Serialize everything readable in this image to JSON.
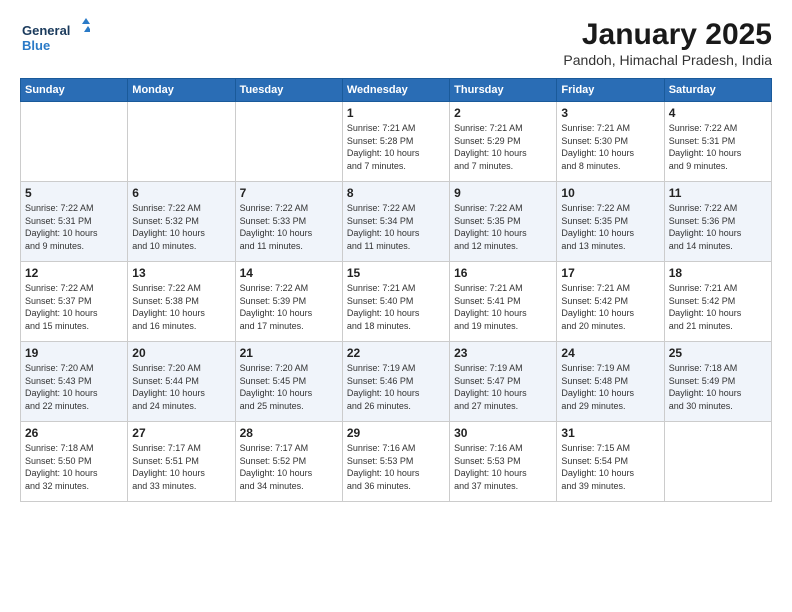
{
  "logo": {
    "line1": "General",
    "line2": "Blue"
  },
  "title": "January 2025",
  "subtitle": "Pandoh, Himachal Pradesh, India",
  "weekdays": [
    "Sunday",
    "Monday",
    "Tuesday",
    "Wednesday",
    "Thursday",
    "Friday",
    "Saturday"
  ],
  "weeks": [
    [
      {
        "day": "",
        "info": ""
      },
      {
        "day": "",
        "info": ""
      },
      {
        "day": "",
        "info": ""
      },
      {
        "day": "1",
        "info": "Sunrise: 7:21 AM\nSunset: 5:28 PM\nDaylight: 10 hours\nand 7 minutes."
      },
      {
        "day": "2",
        "info": "Sunrise: 7:21 AM\nSunset: 5:29 PM\nDaylight: 10 hours\nand 7 minutes."
      },
      {
        "day": "3",
        "info": "Sunrise: 7:21 AM\nSunset: 5:30 PM\nDaylight: 10 hours\nand 8 minutes."
      },
      {
        "day": "4",
        "info": "Sunrise: 7:22 AM\nSunset: 5:31 PM\nDaylight: 10 hours\nand 9 minutes."
      }
    ],
    [
      {
        "day": "5",
        "info": "Sunrise: 7:22 AM\nSunset: 5:31 PM\nDaylight: 10 hours\nand 9 minutes."
      },
      {
        "day": "6",
        "info": "Sunrise: 7:22 AM\nSunset: 5:32 PM\nDaylight: 10 hours\nand 10 minutes."
      },
      {
        "day": "7",
        "info": "Sunrise: 7:22 AM\nSunset: 5:33 PM\nDaylight: 10 hours\nand 11 minutes."
      },
      {
        "day": "8",
        "info": "Sunrise: 7:22 AM\nSunset: 5:34 PM\nDaylight: 10 hours\nand 11 minutes."
      },
      {
        "day": "9",
        "info": "Sunrise: 7:22 AM\nSunset: 5:35 PM\nDaylight: 10 hours\nand 12 minutes."
      },
      {
        "day": "10",
        "info": "Sunrise: 7:22 AM\nSunset: 5:35 PM\nDaylight: 10 hours\nand 13 minutes."
      },
      {
        "day": "11",
        "info": "Sunrise: 7:22 AM\nSunset: 5:36 PM\nDaylight: 10 hours\nand 14 minutes."
      }
    ],
    [
      {
        "day": "12",
        "info": "Sunrise: 7:22 AM\nSunset: 5:37 PM\nDaylight: 10 hours\nand 15 minutes."
      },
      {
        "day": "13",
        "info": "Sunrise: 7:22 AM\nSunset: 5:38 PM\nDaylight: 10 hours\nand 16 minutes."
      },
      {
        "day": "14",
        "info": "Sunrise: 7:22 AM\nSunset: 5:39 PM\nDaylight: 10 hours\nand 17 minutes."
      },
      {
        "day": "15",
        "info": "Sunrise: 7:21 AM\nSunset: 5:40 PM\nDaylight: 10 hours\nand 18 minutes."
      },
      {
        "day": "16",
        "info": "Sunrise: 7:21 AM\nSunset: 5:41 PM\nDaylight: 10 hours\nand 19 minutes."
      },
      {
        "day": "17",
        "info": "Sunrise: 7:21 AM\nSunset: 5:42 PM\nDaylight: 10 hours\nand 20 minutes."
      },
      {
        "day": "18",
        "info": "Sunrise: 7:21 AM\nSunset: 5:42 PM\nDaylight: 10 hours\nand 21 minutes."
      }
    ],
    [
      {
        "day": "19",
        "info": "Sunrise: 7:20 AM\nSunset: 5:43 PM\nDaylight: 10 hours\nand 22 minutes."
      },
      {
        "day": "20",
        "info": "Sunrise: 7:20 AM\nSunset: 5:44 PM\nDaylight: 10 hours\nand 24 minutes."
      },
      {
        "day": "21",
        "info": "Sunrise: 7:20 AM\nSunset: 5:45 PM\nDaylight: 10 hours\nand 25 minutes."
      },
      {
        "day": "22",
        "info": "Sunrise: 7:19 AM\nSunset: 5:46 PM\nDaylight: 10 hours\nand 26 minutes."
      },
      {
        "day": "23",
        "info": "Sunrise: 7:19 AM\nSunset: 5:47 PM\nDaylight: 10 hours\nand 27 minutes."
      },
      {
        "day": "24",
        "info": "Sunrise: 7:19 AM\nSunset: 5:48 PM\nDaylight: 10 hours\nand 29 minutes."
      },
      {
        "day": "25",
        "info": "Sunrise: 7:18 AM\nSunset: 5:49 PM\nDaylight: 10 hours\nand 30 minutes."
      }
    ],
    [
      {
        "day": "26",
        "info": "Sunrise: 7:18 AM\nSunset: 5:50 PM\nDaylight: 10 hours\nand 32 minutes."
      },
      {
        "day": "27",
        "info": "Sunrise: 7:17 AM\nSunset: 5:51 PM\nDaylight: 10 hours\nand 33 minutes."
      },
      {
        "day": "28",
        "info": "Sunrise: 7:17 AM\nSunset: 5:52 PM\nDaylight: 10 hours\nand 34 minutes."
      },
      {
        "day": "29",
        "info": "Sunrise: 7:16 AM\nSunset: 5:53 PM\nDaylight: 10 hours\nand 36 minutes."
      },
      {
        "day": "30",
        "info": "Sunrise: 7:16 AM\nSunset: 5:53 PM\nDaylight: 10 hours\nand 37 minutes."
      },
      {
        "day": "31",
        "info": "Sunrise: 7:15 AM\nSunset: 5:54 PM\nDaylight: 10 hours\nand 39 minutes."
      },
      {
        "day": "",
        "info": ""
      }
    ]
  ]
}
